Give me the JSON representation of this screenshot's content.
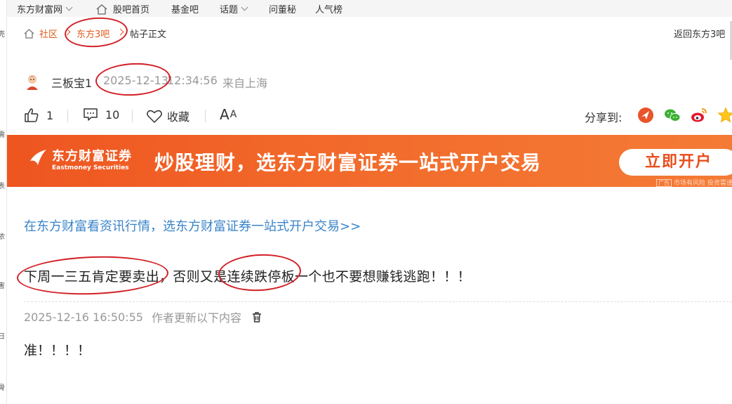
{
  "left_strip": {
    "glyphs": [
      "壳",
      "需",
      "表",
      "依",
      "害",
      "日",
      "骨"
    ]
  },
  "topnav": {
    "site": "东方财富网",
    "home_label": "股吧首页",
    "fund_label": "基金吧",
    "topic_label": "话题",
    "ask_label": "问董秘",
    "rank_label": "人气榜"
  },
  "breadcrumb": {
    "community": "社区",
    "bar": "东方3吧",
    "current": "帖子正文",
    "back": "返回东方3吧"
  },
  "author": {
    "name": "三板宝1",
    "date": "2025-12-13",
    "time": "12:34:56",
    "from": "来自上海"
  },
  "actions": {
    "like_count": "1",
    "comment_count": "10",
    "favorite_label": "收藏",
    "font_label_big": "A",
    "font_label_small": "A",
    "share_label": "分享到:"
  },
  "banner": {
    "brand_cn": "东方财富证券",
    "brand_en": "Eastmoney Securities",
    "slogan": "炒股理财，选东方财富证券一站式开户交易",
    "button": "立即开户",
    "ad_tag": "广告",
    "ad_note": "市场有风险 投资需谨慎"
  },
  "content": {
    "promo_link": "在东方财富看资讯行情，选东方财富证券一站式开户交易>>",
    "post_text": "下周一三五肯定要卖出，否则又是连续跌停板一个也不要想赚钱逃跑！！！",
    "update_time": "2025-12-16 16:50:55",
    "update_label": "作者更新以下内容",
    "update_text": "准！！！！"
  },
  "colors": {
    "accent_orange": "#e05a1b",
    "banner_orange": "#f26a2b",
    "link_blue": "#3a84c9",
    "annotation_red": "#d21f26"
  }
}
